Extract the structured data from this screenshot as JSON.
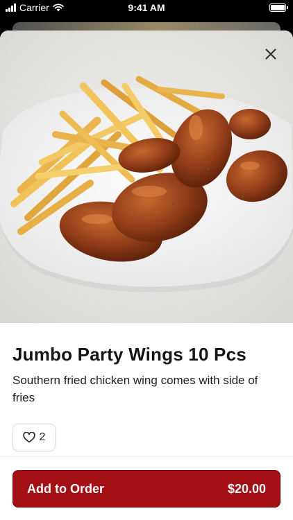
{
  "status_bar": {
    "carrier": "Carrier",
    "time": "9:41 AM",
    "battery_level": 1.0
  },
  "hero": {
    "image_subject": "chicken wings with fries on a white plate",
    "close_icon": "close-icon"
  },
  "product": {
    "title": "Jumbo Party Wings 10 Pcs",
    "description": "Southern fried chicken wing comes with side of fries"
  },
  "likes": {
    "icon": "heart-icon",
    "count": "2"
  },
  "order_button": {
    "label": "Add to Order",
    "price": "$20.00",
    "color": "#a30f14"
  }
}
